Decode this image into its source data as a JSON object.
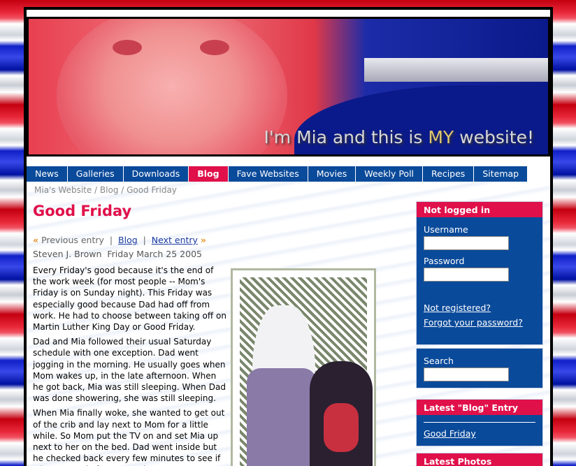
{
  "banner": {
    "tagline_pre": "I'm Mia and this is ",
    "tagline_my": "MY",
    "tagline_post": " website!"
  },
  "nav": {
    "items": [
      {
        "label": "News"
      },
      {
        "label": "Galleries"
      },
      {
        "label": "Downloads"
      },
      {
        "label": "Blog"
      },
      {
        "label": "Fave Websites"
      },
      {
        "label": "Movies"
      },
      {
        "label": "Weekly Poll"
      },
      {
        "label": "Recipes"
      },
      {
        "label": "Sitemap"
      }
    ],
    "active": "Blog"
  },
  "breadcrumb": "Mia's Website / Blog / Good Friday",
  "post": {
    "title": "Good Friday",
    "prev_label": "Previous entry",
    "blog_link": "Blog",
    "next_label": "Next entry",
    "author": "Steven J. Brown",
    "date": "Friday March 25 2005",
    "paragraphs": [
      "Every Friday's good because it's the end of the work week (for most people -- Mom's Friday is on Sunday night). This Friday was especially good because Dad had off from work. He had to choose between taking off on Martin Luther King Day or Good Friday.",
      "Dad and Mia followed their usual Saturday schedule with one exception. Dad went jogging in the morning. He usually goes when Mom wakes up, in the late afternoon. When he got back, Mia was still sleeping. When Dad was done showering, she was still sleeping.",
      "When Mia finally woke, she wanted to get out of the crib and lay next to Mom for a little while. So Mom put the TV on and set Mia up next to her on the bed. Dad went inside but he checked back every few minutes to see if Mia was ready for a pancake."
    ]
  },
  "login": {
    "header": "Not logged in",
    "username_label": "Username",
    "password_label": "Password",
    "not_registered": "Not registered?",
    "forgot_password": "Forgot your password?"
  },
  "search": {
    "label": "Search"
  },
  "latest_blog": {
    "header": "Latest \"Blog\" Entry",
    "entry": "Good Friday"
  },
  "latest_photos": {
    "header": "Latest Photos"
  },
  "colors": {
    "nav_blue": "#0a4a9a",
    "accent_pink": "#e0104a"
  }
}
